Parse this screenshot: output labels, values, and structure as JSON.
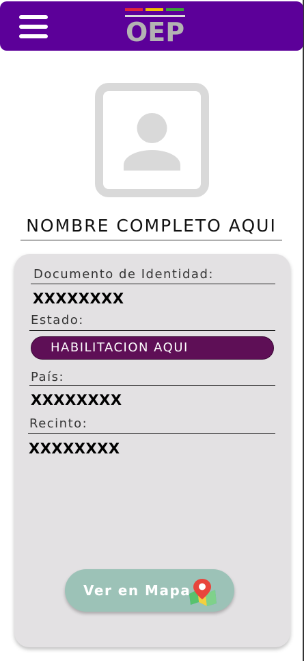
{
  "header": {
    "menu_icon": "hamburger-menu-icon",
    "logo_text": "OEP",
    "logo_bar_colors": [
      "#e2233a",
      "#f2c200",
      "#3aa335"
    ],
    "background_color": "#5c0099"
  },
  "profile": {
    "avatar_icon": "user-placeholder-icon",
    "full_name": "NOMBRE COMPLETO AQUI"
  },
  "card": {
    "document_label": "Documento de Identidad:",
    "document_value": "XXXXXXXX",
    "status_label": "Estado:",
    "status_value": "HABILITACION AQUI",
    "country_label": "País:",
    "country_value": "XXXXXXXX",
    "venue_label": "Recinto:",
    "venue_value": "XXXXXXXX"
  },
  "map_button": {
    "label": "Ver en Mapa",
    "icon": "map-pin-icon",
    "color": "#9cc2b7"
  },
  "colors": {
    "status_pill": "#5e0f56",
    "card_background": "#e3e1e3"
  }
}
